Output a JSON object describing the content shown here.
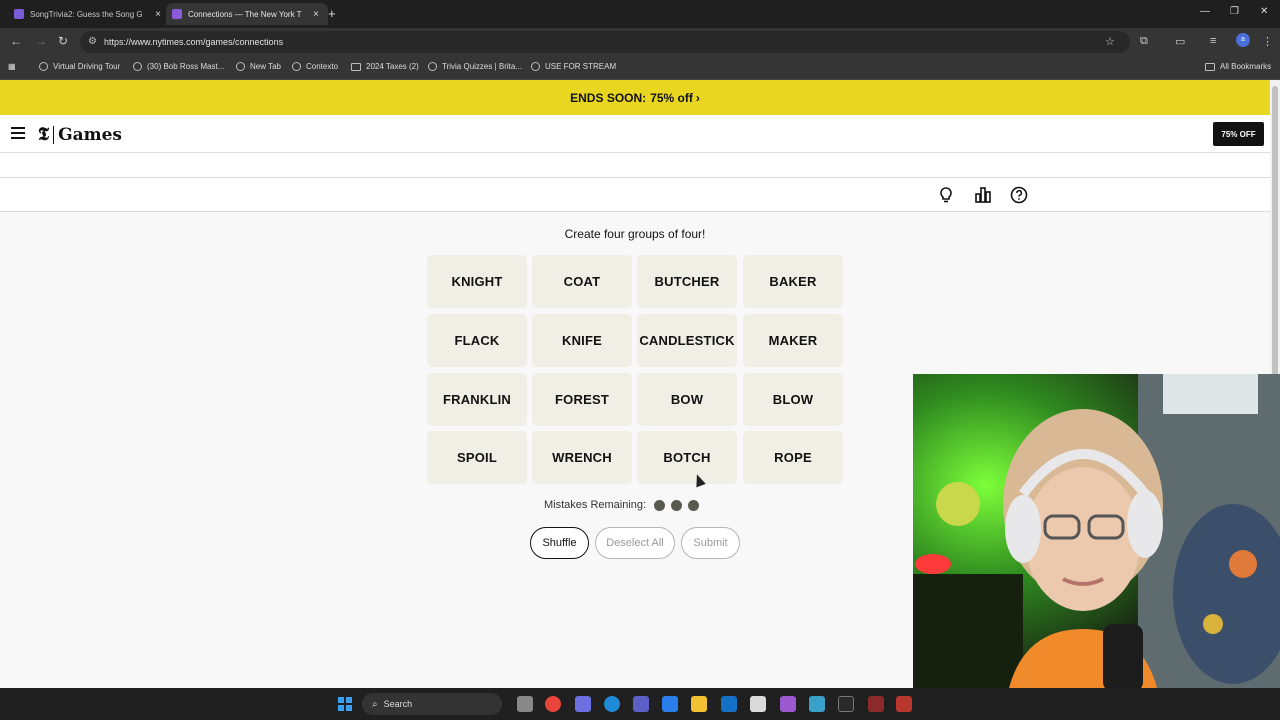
{
  "browser": {
    "tabs": [
      {
        "title": "SongTrivia2: Guess the Song G",
        "active": false
      },
      {
        "title": "Connections — The New York T",
        "active": true
      }
    ],
    "url": "https://www.nytimes.com/games/connections",
    "bookmarks": [
      {
        "label": "Virtual Driving Tour"
      },
      {
        "label": "(30) Bob Ross Mast..."
      },
      {
        "label": "New Tab"
      },
      {
        "label": "Contexto"
      },
      {
        "label": "2024 Taxes (2)"
      },
      {
        "label": "Trivia Quizzes | Brita..."
      },
      {
        "label": "USE FOR STREAM"
      }
    ],
    "all_bookmarks_label": "All Bookmarks"
  },
  "promo": {
    "text": "ENDS SOON:",
    "pct": "75% off"
  },
  "header": {
    "logo_t": "𝕿",
    "logo_games": "Games",
    "subscribe_label": "75% OFF"
  },
  "game": {
    "instruction": "Create four groups of four!",
    "tiles": [
      "KNIGHT",
      "COAT",
      "BUTCHER",
      "BAKER",
      "FLACK",
      "KNIFE",
      "CANDLESTICK",
      "MAKER",
      "FRANKLIN",
      "FOREST",
      "BOW",
      "BLOW",
      "SPOIL",
      "WRENCH",
      "BOTCH",
      "ROPE"
    ],
    "mistakes_label": "Mistakes Remaining:",
    "mistakes_remaining": 3,
    "buttons": {
      "shuffle": "Shuffle",
      "deselect": "Deselect All",
      "submit": "Submit"
    }
  },
  "taskbar": {
    "search_label": "Search"
  },
  "colors": {
    "promo_bg": "#e9d621",
    "tile_bg": "#efefe6",
    "dot": "#5a594e"
  }
}
